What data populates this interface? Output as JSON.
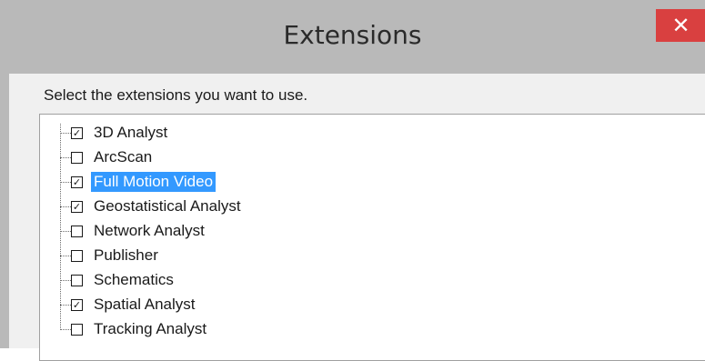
{
  "window": {
    "title": "Extensions",
    "close_label": "✕"
  },
  "dialog": {
    "prompt": "Select the extensions you want to use."
  },
  "extensions": [
    {
      "label": "3D Analyst",
      "checked": true,
      "selected": false
    },
    {
      "label": "ArcScan",
      "checked": false,
      "selected": false
    },
    {
      "label": "Full Motion Video",
      "checked": true,
      "selected": true
    },
    {
      "label": "Geostatistical Analyst",
      "checked": true,
      "selected": false
    },
    {
      "label": "Network Analyst",
      "checked": false,
      "selected": false
    },
    {
      "label": "Publisher",
      "checked": false,
      "selected": false
    },
    {
      "label": "Schematics",
      "checked": false,
      "selected": false
    },
    {
      "label": "Spatial Analyst",
      "checked": true,
      "selected": false
    },
    {
      "label": "Tracking Analyst",
      "checked": false,
      "selected": false
    }
  ]
}
